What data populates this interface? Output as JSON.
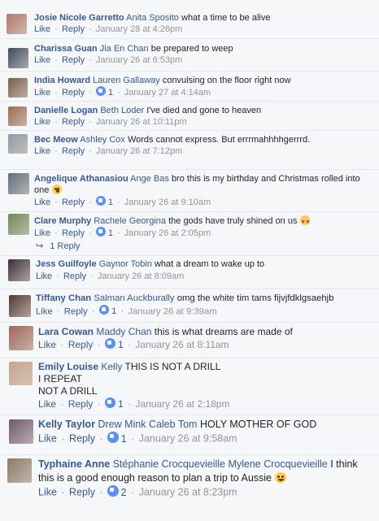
{
  "labels": {
    "like": "Like",
    "reply": "Reply",
    "sep": " · "
  },
  "comments": [
    {
      "author": "Josie Nicole Garretto",
      "tags": "Anita Sposito",
      "text": "what a time to be alive",
      "time": "January 28 at 4:26pm",
      "reactions": "",
      "avatar": "#b07a6b"
    },
    {
      "author": "Charissa Guan",
      "tags": "Jia En Chan",
      "text": "be prepared to weep",
      "time": "January 26 at 6:53pm",
      "reactions": "",
      "avatar": "#3b4a63"
    },
    {
      "author": "India Howard",
      "tags": "Lauren Gallaway",
      "text": "convulsing on the floor right now",
      "time": "January 27 at 4:14am",
      "reactions": "1",
      "avatar": "#7a5a4e"
    },
    {
      "author": "Danielle Logan",
      "tags": "Beth Loder",
      "text": "I've died and gone to heaven",
      "time": "January 26 at 10:11pm",
      "reactions": "",
      "avatar": "#9b6c52"
    },
    {
      "author": "Bec Meow",
      "tags": "Ashley Cox",
      "text": "Words cannot express. But errrmahhhhgerrrd.",
      "time": "January 26 at 7:12pm",
      "reactions": "",
      "avatar": "#8b9aa8"
    },
    {
      "author": "Angelique Athanasiou",
      "tags": "Ange Bas",
      "text": "bro this is my birthday and Christmas rolled into one",
      "time": "January 26 at 9:10am",
      "reactions": "1",
      "avatar": "#5f6e7d",
      "emoji": "wow"
    },
    {
      "author": "Clare Murphy",
      "tags": "Rachele Georgina",
      "text": "the gods have truly shined on us",
      "time": "January 26 at 2:05pm",
      "reactions": "1",
      "avatar": "#6e8b5a",
      "emoji": "hearteyes"
    },
    {
      "author": "Jess Guilfoyle",
      "tags": "Gaynor Tobin",
      "text": "what a dream to wake up to",
      "time": "January 26 at 8:09am",
      "reactions": "",
      "avatar": "#3a2f3a"
    },
    {
      "author": "Tiffany Chan",
      "tags": "Salman Auckburally",
      "text": "omg the white tim tams fijvjfdklgsaehjb",
      "time": "January 26 at 9:39am",
      "reactions": "1",
      "avatar": "#4d3a33"
    },
    {
      "author": "Lara Cowan",
      "tags": "Maddy Chan",
      "text": "this is what dreams are made of",
      "time": "January 26 at 8:11am",
      "reactions": "1",
      "avatar": "#a0655a"
    },
    {
      "author": "Emily Louise",
      "tags": "Kelly",
      "text": "THIS IS NOT A DRILL\nI REPEAT\nNOT A DRILL",
      "time": "January 26 at 2:18pm",
      "reactions": "1",
      "avatar": "#c7a48a"
    },
    {
      "author": "Kelly Taylor",
      "tags": "Drew Mink Caleb Tom",
      "text": "HOLY MOTHER OF GOD",
      "time": "January 26 at 9:58am",
      "reactions": "1",
      "avatar": "#6b5a6e"
    },
    {
      "author": "Typhaine Anne",
      "tags": "Stéphanie Crocquevieille Mylene Crocquevieille",
      "text": "I think this is a good enough reason to plan a trip to Aussie",
      "time": "January 26 at 8:23pm",
      "reactions": "2",
      "avatar": "#8a7a6a",
      "emoji": "laugh"
    }
  ],
  "reply_summary": {
    "arrow": "↪",
    "text": "1 Reply"
  }
}
